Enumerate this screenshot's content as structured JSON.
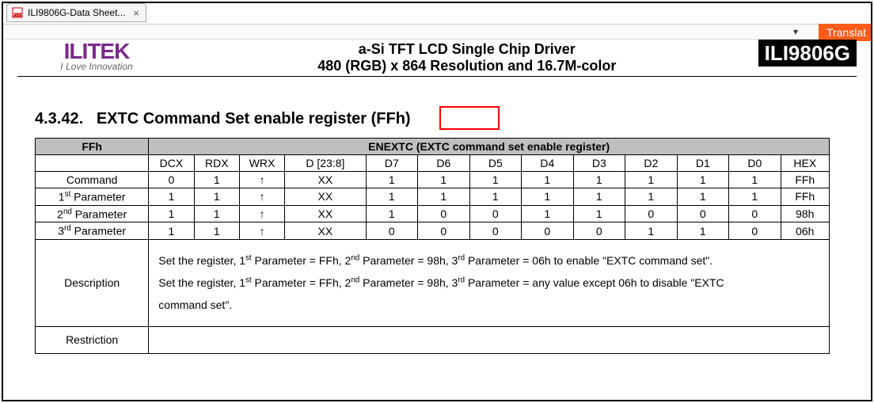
{
  "tab": {
    "title": "ILI9806G-Data Sheet...",
    "close": "×"
  },
  "toolbar": {
    "dropdown": "▾",
    "translate": "Translat"
  },
  "header": {
    "logo_top": "ILITEK",
    "logo_sub": "I Love Innovation",
    "title1": "a-Si TFT LCD Single Chip Driver",
    "title2": "480 (RGB) x 864 Resolution and 16.7M-color",
    "chip": "ILI9806G"
  },
  "section": {
    "num": "4.3.42.",
    "title_a": "EXTC Command Set enable register",
    "title_b": " (FFh)"
  },
  "table": {
    "top_left": "FFh",
    "top_right": "ENEXTC (EXTC command set enable register)",
    "cols": [
      "",
      "DCX",
      "RDX",
      "WRX",
      "D [23:8]",
      "D7",
      "D6",
      "D5",
      "D4",
      "D3",
      "D2",
      "D1",
      "D0",
      "HEX"
    ],
    "rows": [
      {
        "label": "Command",
        "cells": [
          "0",
          "1",
          "↑",
          "XX",
          "1",
          "1",
          "1",
          "1",
          "1",
          "1",
          "1",
          "1",
          "FFh"
        ]
      },
      {
        "label": "1st Parameter",
        "cells": [
          "1",
          "1",
          "↑",
          "XX",
          "1",
          "1",
          "1",
          "1",
          "1",
          "1",
          "1",
          "1",
          "FFh"
        ]
      },
      {
        "label": "2nd Parameter",
        "cells": [
          "1",
          "1",
          "↑",
          "XX",
          "1",
          "0",
          "0",
          "1",
          "1",
          "0",
          "0",
          "0",
          "98h"
        ]
      },
      {
        "label": "3rd Parameter",
        "cells": [
          "1",
          "1",
          "↑",
          "XX",
          "0",
          "0",
          "0",
          "0",
          "0",
          "1",
          "1",
          "0",
          "06h"
        ]
      }
    ],
    "desc_label": "Description",
    "desc_line1a": "Set the register, 1",
    "desc_line1b": " Parameter = FFh, 2",
    "desc_line1c": " Parameter = 98h, 3",
    "desc_line1d": " Parameter = 06h to enable \"EXTC command set\".",
    "desc_line2a": "Set the register, 1",
    "desc_line2b": " Parameter = FFh, 2",
    "desc_line2c": " Parameter = 98h, 3",
    "desc_line2d": " Parameter = any value except 06h to disable \"EXTC",
    "desc_line3": "command set\".",
    "restriction_label": "Restriction"
  },
  "sup": {
    "st": "st",
    "nd": "nd",
    "rd": "rd"
  }
}
